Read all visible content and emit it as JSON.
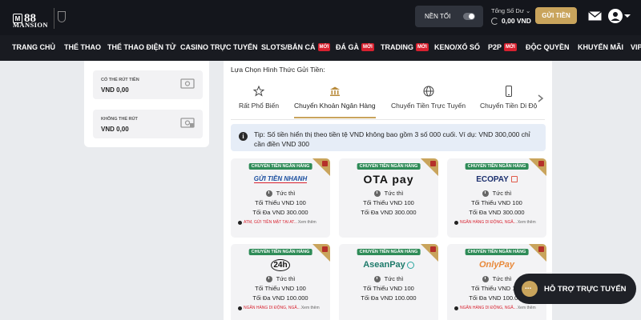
{
  "header": {
    "logo_number": "88",
    "logo_sub": "MANSION",
    "dark_mode_label": "NỀN TỐI",
    "balance_label": "Tổng Số Dư",
    "balance_value": "0,00 VND",
    "deposit_button": "GỬI TIỀN"
  },
  "nav": [
    {
      "label": "TRANG CHỦ",
      "badge": ""
    },
    {
      "label": "THỂ THAO",
      "badge": ""
    },
    {
      "label": "THỂ THAO ĐIỆN TỬ",
      "badge": ""
    },
    {
      "label": "CASINO TRỰC TUYẾN",
      "badge": ""
    },
    {
      "label": "SLOTS/BẮN CÁ",
      "badge": "MỚI"
    },
    {
      "label": "ĐÁ GÀ",
      "badge": "MỚI"
    },
    {
      "label": "TRADING",
      "badge": "MỚI"
    },
    {
      "label": "KENO/XỔ SỐ",
      "badge": ""
    },
    {
      "label": "P2P",
      "badge": "MỚI"
    },
    {
      "label": "ĐỘC QUYỀN",
      "badge": ""
    },
    {
      "label": "KHUYẾN MÃI",
      "badge": ""
    },
    {
      "label": "VIP",
      "badge": ""
    }
  ],
  "account": {
    "withdrawable_label": "CÓ THỂ RÚT TIỀN",
    "withdrawable_value": "VND  0,00",
    "non_withdrawable_label": "KHÔNG THỂ RÚT",
    "non_withdrawable_value": "VND  0,00"
  },
  "deposit": {
    "section_title": "Lựa Chọn Hình Thức Gửi Tiền:",
    "methods": [
      {
        "label": "Rất Phổ Biến",
        "icon": "star-icon",
        "active": false
      },
      {
        "label": "Chuyển Khoản Ngân Hàng",
        "icon": "bank-icon",
        "active": true
      },
      {
        "label": "Chuyển Tiền Trực Tuyến",
        "icon": "globe-icon",
        "active": false
      },
      {
        "label": "Chuyển Tiền Di Độ",
        "icon": "phone-icon",
        "active": false
      }
    ],
    "tip": "Tip: Số tiền hiển thị theo tiền tệ VND không bao gồm 3 số 000 cuối. Ví dụ: VND 300,000 chỉ cần điền VND 300",
    "cards": [
      {
        "tag": "CHUYỂN TIỀN NGÂN HÀNG",
        "brand": "GỬI TIỀN NHANH",
        "speed": "Tức thì",
        "min": "Tối Thiểu VND 100",
        "max": "Tối Đa VND 300.000",
        "note": "ATM, GỬI TIỀN MẶT TẠI AT...",
        "more": "Xem thêm"
      },
      {
        "tag": "CHUYỂN TIỀN NGÂN HÀNG",
        "brand": "OTA pay",
        "speed": "Tức thì",
        "min": "Tối Thiểu VND 100",
        "max": "Tối Đa VND 300.000",
        "note": "",
        "more": ""
      },
      {
        "tag": "CHUYỂN TIỀN NGÂN HÀNG",
        "brand": "ECOPAY",
        "speed": "Tức thì",
        "min": "Tối Thiểu VND 100",
        "max": "Tối Đa VND 300.000",
        "note": "NGÂN HÀNG DI ĐỘNG, NGÂ...",
        "more": "Xem thêm"
      },
      {
        "tag": "CHUYỂN TIỀN NGÂN HÀNG",
        "brand": "24h",
        "speed": "Tức thì",
        "min": "Tối Thiểu VND 100",
        "max": "Tối Đa VND 100.000",
        "note": "NGÂN HÀNG DI ĐỘNG, NGÂ...",
        "more": "Xem thêm"
      },
      {
        "tag": "CHUYỂN TIỀN NGÂN HÀNG",
        "brand": "AseanPay",
        "speed": "Tức thì",
        "min": "Tối Thiểu VND 100",
        "max": "Tối Đa VND 100.000",
        "note": "",
        "more": ""
      },
      {
        "tag": "CHUYỂN TIỀN NGÂN HÀNG",
        "brand": "OnlyPay",
        "speed": "Tức thì",
        "min": "Tối Thiểu VND 100",
        "max": "Tối Đa VND 100.000",
        "note": "NGÂN HÀNG DI ĐỘNG, NGÂ...",
        "more": "Xem thêm"
      }
    ]
  },
  "support": {
    "label": "HỖ TRỢ TRỰC TUYẾN"
  },
  "colors": {
    "gold": "#c9a45c",
    "header_bg": "#14161c",
    "tag_green": "#2e8b57",
    "badge_red": "#d8212f"
  }
}
